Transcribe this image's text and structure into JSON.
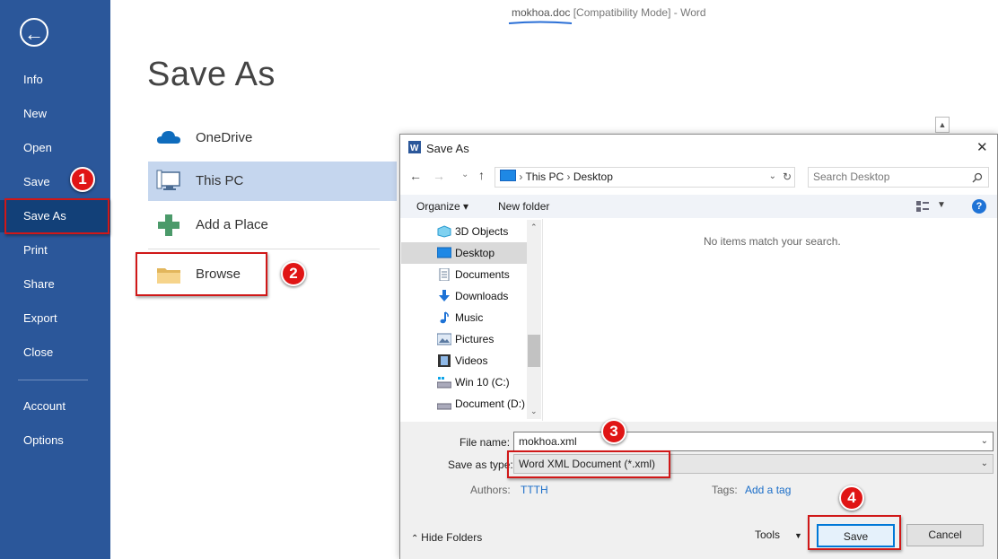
{
  "window": {
    "title_filename": "mokhoa.doc",
    "title_rest": " [Compatibility Mode] - Word"
  },
  "backstage": {
    "back_glyph": "←",
    "nav": [
      {
        "label": "Info"
      },
      {
        "label": "New"
      },
      {
        "label": "Open"
      },
      {
        "label": "Save"
      },
      {
        "label": "Save As"
      },
      {
        "label": "Print"
      },
      {
        "label": "Share"
      },
      {
        "label": "Export"
      },
      {
        "label": "Close"
      },
      {
        "label": "Account"
      },
      {
        "label": "Options"
      }
    ],
    "active_nav": "Save As"
  },
  "main": {
    "title": "Save As",
    "locations": [
      {
        "label": "OneDrive",
        "icon": "cloud-icon"
      },
      {
        "label": "This PC",
        "icon": "computer-icon",
        "selected": true
      },
      {
        "label": "Add a Place",
        "icon": "plus-icon"
      },
      {
        "label": "Browse",
        "icon": "folder-icon"
      }
    ]
  },
  "annotations": {
    "badges": [
      "1",
      "2",
      "3",
      "4"
    ],
    "color": "#d01818"
  },
  "dialog": {
    "title": "Save As",
    "close_glyph": "✕",
    "breadcrumb": [
      "This PC",
      "Desktop"
    ],
    "search_placeholder": "Search Desktop",
    "organize_label": "Organize ▾",
    "new_folder_label": "New folder",
    "help_glyph": "?",
    "tree": [
      {
        "label": "3D Objects",
        "icon": "cube-icon"
      },
      {
        "label": "Desktop",
        "icon": "desktop-icon",
        "selected": true
      },
      {
        "label": "Documents",
        "icon": "document-icon"
      },
      {
        "label": "Downloads",
        "icon": "download-icon"
      },
      {
        "label": "Music",
        "icon": "music-icon"
      },
      {
        "label": "Pictures",
        "icon": "pictures-icon"
      },
      {
        "label": "Videos",
        "icon": "video-icon"
      },
      {
        "label": "Win 10 (C:)",
        "icon": "drive-icon"
      },
      {
        "label": "Document (D:)",
        "icon": "drive-icon"
      }
    ],
    "empty_message": "No items match your search.",
    "file_name_label": "File name:",
    "file_name_value": "mokhoa.xml",
    "save_type_label": "Save as type:",
    "save_type_value": "Word XML Document (*.xml)",
    "authors_label": "Authors:",
    "authors_value": "TTTH",
    "tags_label": "Tags:",
    "tags_value": "Add a tag",
    "hide_folders_label": "Hide Folders",
    "tools_label": "Tools",
    "save_label": "Save",
    "cancel_label": "Cancel"
  }
}
